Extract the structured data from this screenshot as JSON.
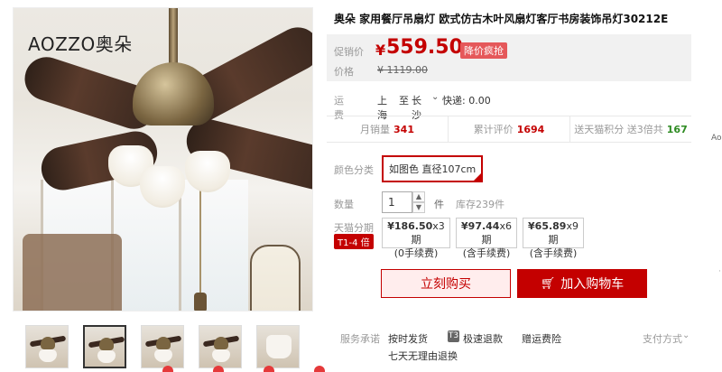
{
  "image": {
    "brand_logo": "AOZZO奥朵"
  },
  "product": {
    "title": "奥朵 家用餐厅吊扇灯 欧式仿古木叶风扇灯客厅书房装饰吊灯30212E",
    "promo_label": "促销价",
    "currency": "¥",
    "price": "559.50",
    "promo_tag": "降价疯抢",
    "orig_label": "价格",
    "orig_price": "¥ 1119.00"
  },
  "shipping": {
    "label": "运费",
    "from": "上海",
    "to": "至",
    "city": "长沙",
    "fee": "快递: 0.00"
  },
  "stats": {
    "monthly_label": "月销量",
    "monthly_value": "341",
    "reviews_label": "累计评价",
    "reviews_value": "1694",
    "points_label": "送天猫积分 送3倍共",
    "points_value": "167"
  },
  "sku": {
    "color_label": "颜色分类",
    "selected": "如图色 直径107cm"
  },
  "quantity": {
    "label": "数量",
    "value": "1",
    "unit": "件",
    "stock": "库存239件"
  },
  "installment": {
    "label": "天猫分期",
    "badge": "T1-4 倍",
    "options": [
      {
        "price": "¥186.50",
        "periods": "x3期",
        "fee": "(0手续费)"
      },
      {
        "price": "¥97.44",
        "periods": "x6期",
        "fee": "(含手续费)"
      },
      {
        "price": "¥65.89",
        "periods": "x9期",
        "fee": "(含手续费)"
      }
    ]
  },
  "actions": {
    "buy_now": "立刻购买",
    "add_cart": "加入购物车"
  },
  "service": {
    "label": "服务承诺",
    "item1": "按时发货",
    "item2_badge": "T3",
    "item2": "极速退款",
    "item3": "赠运费险",
    "item4": "七天无理由退换",
    "payment": "支付方式"
  },
  "side": {
    "cut_text": "Ao"
  },
  "colors": {
    "accent": "#c40000",
    "promo_bg": "#e5585a",
    "points": "#2e8b22"
  }
}
